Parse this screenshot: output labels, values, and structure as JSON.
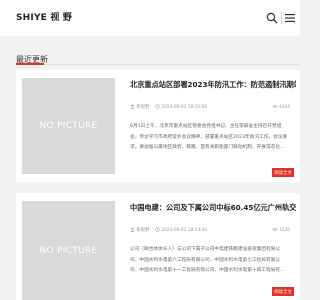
{
  "header": {
    "logo_text": "SHIYE 视 野",
    "search_icon": "search-icon",
    "menu_icon": "hamburger-menu-icon"
  },
  "section": {
    "title": "最近更新",
    "accent_color": "#e0312b"
  },
  "placeholder_text": "NO PICTURE",
  "read_more_label": "阅读全文",
  "articles": [
    {
      "title": "北京重点站区部署2023年防汛工作：防范遏制汛期站区…",
      "author": "新视野",
      "date": "2023-06-02 18:15:08",
      "views": "4304",
      "excerpt_lines": [
        "6月1日上午，北京市重点站区管委会党组书记、主任李辰舍主持召开党组",
        "会，传达学习市政府常务会议精神，部署重点站区2023年防汛工作。会议要",
        "求，要加强与属地区政府、铁路、首有关职能部门联动机制，开展常态化…"
      ]
    },
    {
      "title": "中国电建：公司及下属公司中标60.45亿元广州轨交项目",
      "author": "新视野",
      "date": "2023-06-02 18:13:34",
      "views": "1226",
      "excerpt_lines": [
        "公司（联合体体头人）与公司下属子公司中电建铁路建设投资集团有限公",
        "司、中国水利水电第六工程局有限公司、中国水利水电第七工程局有限公",
        "司、中国水利水电第十一工程局有限公司、中国水利水电第十四工程局有…"
      ]
    }
  ]
}
